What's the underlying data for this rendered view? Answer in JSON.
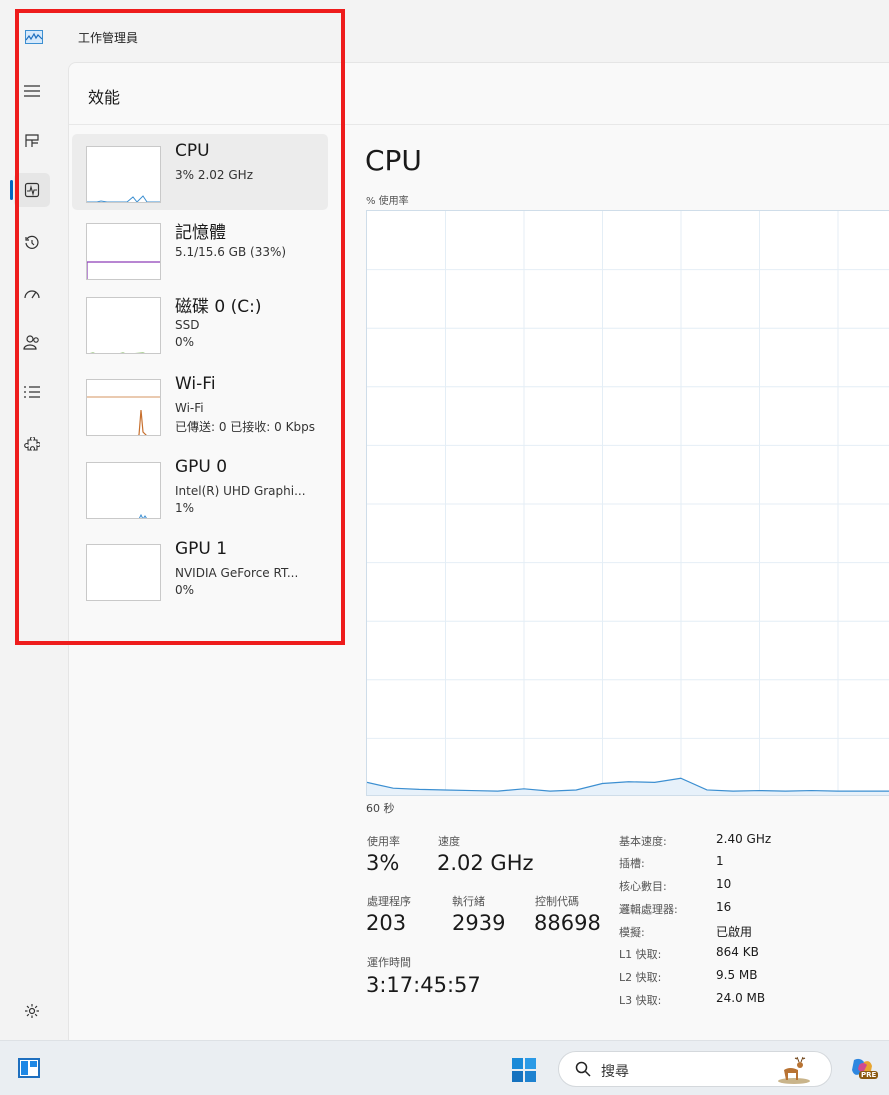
{
  "window": {
    "title": "工作管理員"
  },
  "page": {
    "title": "效能"
  },
  "sidebar": {
    "items": [
      {
        "name": "menu",
        "icon": "hamburger-menu-icon"
      },
      {
        "name": "processes",
        "icon": "processes-grid-icon"
      },
      {
        "name": "performance",
        "icon": "performance-chart-icon",
        "active": true
      },
      {
        "name": "app-history",
        "icon": "history-icon"
      },
      {
        "name": "startup-apps",
        "icon": "speedometer-icon"
      },
      {
        "name": "users",
        "icon": "users-icon"
      },
      {
        "name": "details",
        "icon": "list-icon"
      },
      {
        "name": "services",
        "icon": "puzzle-icon"
      }
    ],
    "settings_icon": "gear-icon"
  },
  "devices": [
    {
      "name": "CPU",
      "line1": "3% 2.02 GHz",
      "line2": "",
      "line3": "",
      "color": "#3c8fd1"
    },
    {
      "name": "記憶體",
      "line1": "5.1/15.6 GB (33%)",
      "line2": "",
      "line3": "",
      "color": "#8d3fb8"
    },
    {
      "name": "磁碟 0 (C:)",
      "line1": "SSD",
      "line2": "0%",
      "line3": "",
      "color": "#5ea532"
    },
    {
      "name": "Wi-Fi",
      "line1": "Wi-Fi",
      "line2": "已傳送: 0 已接收: 0 Kbps",
      "line3": "",
      "color": "#c7702e"
    },
    {
      "name": "GPU 0",
      "line1": "Intel(R) UHD Graphi...",
      "line2": "1%",
      "line3": "",
      "color": "#3c8fd1"
    },
    {
      "name": "GPU 1",
      "line1": "NVIDIA GeForce RT...",
      "line2": "0%",
      "line3": "",
      "color": "#3c8fd1"
    }
  ],
  "detail": {
    "title": "CPU",
    "graph_label": "% 使用率",
    "time_label": "60 秒",
    "stats": {
      "usage_label": "使用率",
      "usage_value": "3%",
      "speed_label": "速度",
      "speed_value": "2.02 GHz",
      "processes_label": "處理程序",
      "processes_value": "203",
      "threads_label": "執行緒",
      "threads_value": "2939",
      "handles_label": "控制代碼",
      "handles_value": "88698",
      "uptime_label": "運作時間",
      "uptime_value": "3:17:45:57"
    },
    "specs": [
      {
        "label": "基本速度:",
        "value": "2.40 GHz"
      },
      {
        "label": "插槽:",
        "value": "1"
      },
      {
        "label": "核心數目:",
        "value": "10"
      },
      {
        "label": "邏輯處理器:",
        "value": "16"
      },
      {
        "label": "模擬:",
        "value": "已啟用"
      },
      {
        "label": "L1 快取:",
        "value": "864 KB"
      },
      {
        "label": "L2 快取:",
        "value": "9.5 MB"
      },
      {
        "label": "L3 快取:",
        "value": "24.0 MB"
      }
    ],
    "cpu_history_percent": [
      2.5,
      1.5,
      1.3,
      1.2,
      1.1,
      1.0,
      1.4,
      1.0,
      1.2,
      2.3,
      2.6,
      2.5,
      3.2,
      1.2,
      1.0,
      1.1,
      1.0,
      1.1,
      1.0,
      1.0,
      1.0
    ],
    "line_color": "#3c8fd1"
  },
  "taskbar": {
    "search_placeholder": "搜尋",
    "copilot_badge": "PRE"
  },
  "colors": {
    "highlight_box": "#ee1c1c",
    "accent": "#0067c0"
  }
}
